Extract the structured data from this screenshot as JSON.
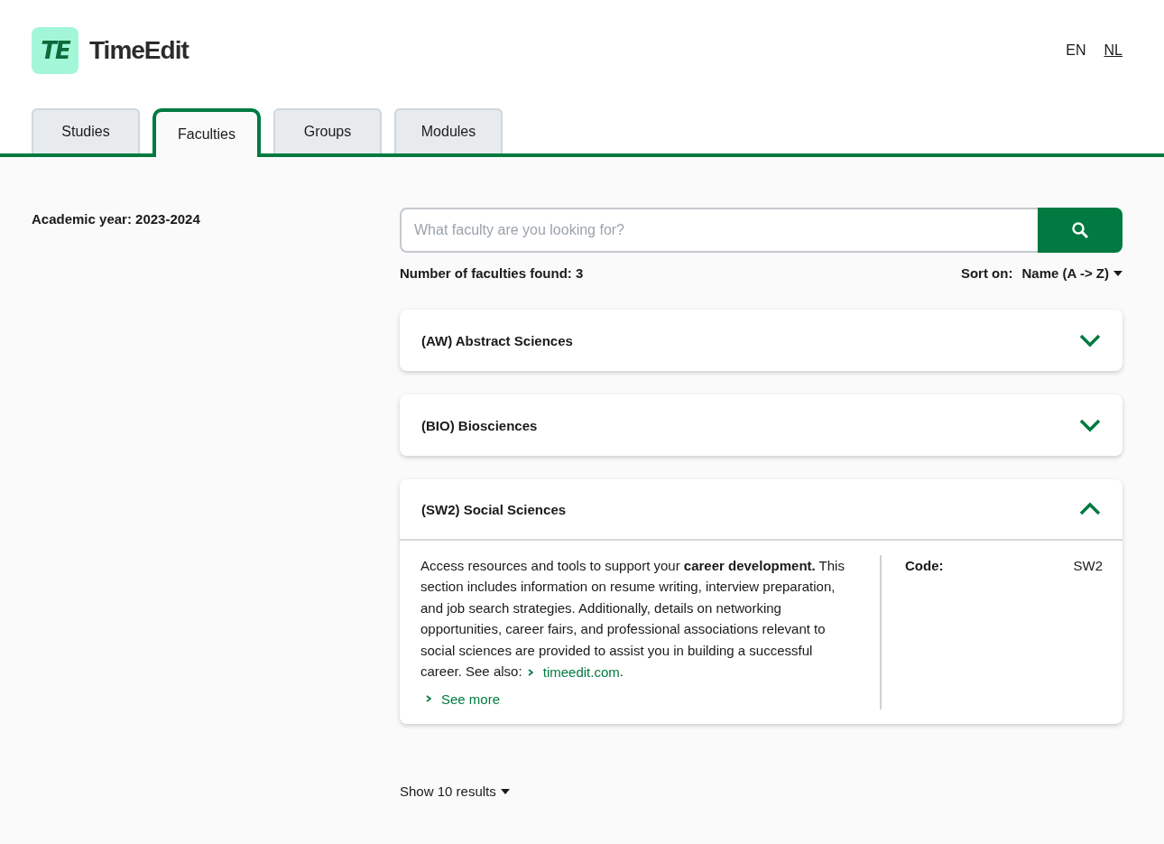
{
  "logo": {
    "mark": "TE",
    "name": "TimeEdit"
  },
  "languages": [
    {
      "label": "EN",
      "selected": true
    },
    {
      "label": "NL",
      "selected": false
    }
  ],
  "tabs": [
    {
      "label": "Studies",
      "selected": false
    },
    {
      "label": "Faculties",
      "selected": true
    },
    {
      "label": "Groups",
      "selected": false
    },
    {
      "label": "Modules",
      "selected": false
    }
  ],
  "academic_year": "Academic year: 2023-2024",
  "search": {
    "placeholder": "What faculty are you looking for?"
  },
  "results_count": "Number of faculties found: 3",
  "sort": {
    "label": "Sort on:",
    "value": "Name (A -> Z)"
  },
  "faculties": [
    {
      "title": "(AW) Abstract Sciences",
      "expanded": false
    },
    {
      "title": "(BIO) Biosciences",
      "expanded": false
    },
    {
      "title": "(SW2) Social Sciences",
      "expanded": true,
      "description": "Access resources and tools to support your **career development.** This section includes information on resume writing, interview preparation, and job search strategies. Additionally, details on networking opportunities, career fairs, and professional associations relevant to social sciences are provided to assist you in building a successful career. See also: ",
      "link": "timeedit.com",
      "after_link": ".",
      "see_more": "See more",
      "code_label": "Code:",
      "code_value": "SW2"
    }
  ],
  "page_size": "Show 10 results"
}
